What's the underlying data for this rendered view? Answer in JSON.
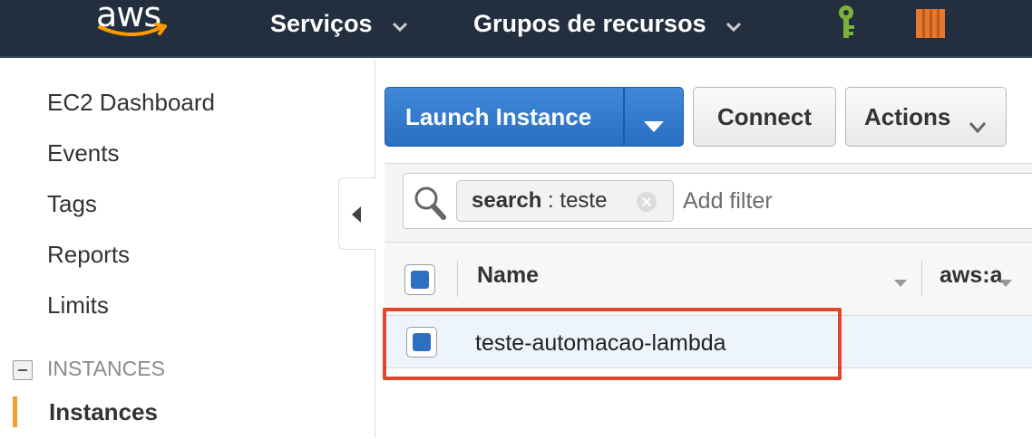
{
  "topbar": {
    "logo_text": "aws",
    "services_label": "Serviços",
    "groups_label": "Grupos de recursos",
    "colors": {
      "background": "#232f3e",
      "logo_smile": "#f90",
      "key_icon": "#7bb03c",
      "box_icon": "#e8772e"
    }
  },
  "sidebar": {
    "items": [
      {
        "label": "EC2 Dashboard"
      },
      {
        "label": "Events"
      },
      {
        "label": "Tags"
      },
      {
        "label": "Reports"
      },
      {
        "label": "Limits"
      }
    ],
    "section_title": "INSTANCES",
    "active_item": "Instances",
    "active_color": "#f39c33"
  },
  "toolbar": {
    "launch_label": "Launch Instance",
    "connect_label": "Connect",
    "actions_label": "Actions",
    "launch_color": "#2f7bd0"
  },
  "filter": {
    "token_key": "search",
    "token_sep": " : ",
    "token_value": "teste",
    "placeholder": "Add filter"
  },
  "table": {
    "columns": [
      "Name",
      "aws:a"
    ],
    "rows": [
      {
        "name": "teste-automacao-lambda"
      }
    ],
    "highlight_color": "#e0462d"
  }
}
